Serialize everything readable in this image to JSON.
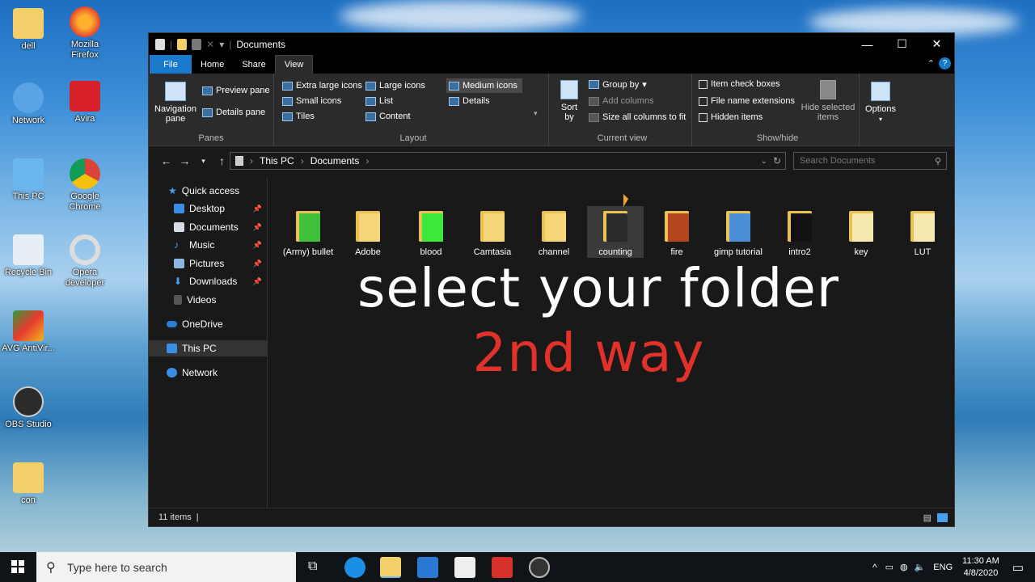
{
  "desktop": {
    "icons": [
      {
        "label": "dell"
      },
      {
        "label": "Mozilla Firefox"
      },
      {
        "label": "Network"
      },
      {
        "label": "Avira"
      },
      {
        "label": "This PC"
      },
      {
        "label": "Google Chrome"
      },
      {
        "label": "Recycle Bin"
      },
      {
        "label": "Opera developer"
      },
      {
        "label": "AVG AntiVir..."
      },
      {
        "label": "OBS Studio"
      },
      {
        "label": "con"
      }
    ]
  },
  "window": {
    "title": "Documents",
    "controls": {
      "minimize": "—",
      "maximize": "☐",
      "close": "✕"
    },
    "tabs": [
      "File",
      "Home",
      "Share",
      "View"
    ],
    "active_tab": "View"
  },
  "ribbon": {
    "panes": {
      "navigation_pane": "Navigation pane",
      "preview_pane": "Preview pane",
      "details_pane": "Details pane",
      "label": "Panes"
    },
    "layout": {
      "extra_large_icons": "Extra large icons",
      "large_icons": "Large icons",
      "medium_icons": "Medium icons",
      "small_icons": "Small icons",
      "list": "List",
      "details": "Details",
      "tiles": "Tiles",
      "content": "Content",
      "label": "Layout"
    },
    "current_view": {
      "sort_by": "Sort by",
      "group_by": "Group by",
      "add_columns": "Add columns",
      "size_all_columns": "Size all columns to fit",
      "label": "Current view"
    },
    "show_hide": {
      "item_check_boxes": "Item check boxes",
      "file_name_extensions": "File name extensions",
      "hidden_items": "Hidden items",
      "hide_selected_items": "Hide selected items",
      "label": "Show/hide"
    },
    "options": "Options"
  },
  "address": {
    "crumbs": [
      "This PC",
      "Documents"
    ],
    "search_placeholder": "Search Documents"
  },
  "nav_pane": {
    "quick_access": "Quick access",
    "items": [
      "Desktop",
      "Documents",
      "Music",
      "Pictures",
      "Downloads",
      "Videos"
    ],
    "onedrive": "OneDrive",
    "this_pc": "This PC",
    "network": "Network"
  },
  "folders": [
    {
      "name": "(Army) bullet",
      "color": "#3fc23a"
    },
    {
      "name": "Adobe",
      "color": "#f5d77a"
    },
    {
      "name": "blood",
      "color": "#3ee83a"
    },
    {
      "name": "Camtasia",
      "color": "#f5d77a"
    },
    {
      "name": "channel",
      "color": "#f5d77a"
    },
    {
      "name": "counting",
      "color": "#2a2a2a"
    },
    {
      "name": "fire",
      "color": "#b3461c"
    },
    {
      "name": "gimp tutorial",
      "color": "#4b8fd8"
    },
    {
      "name": "intro2",
      "color": "#111111"
    },
    {
      "name": "key",
      "color": "#f5e9b0"
    },
    {
      "name": "LUT",
      "color": "#f5e9b0"
    }
  ],
  "overlay": {
    "line1": "select your folder",
    "line2": "2nd way"
  },
  "status": {
    "count": "11 items"
  },
  "taskbar": {
    "search_placeholder": "Type here to search",
    "time": "11:30 AM",
    "date": "4/8/2020",
    "lang": "ENG"
  }
}
